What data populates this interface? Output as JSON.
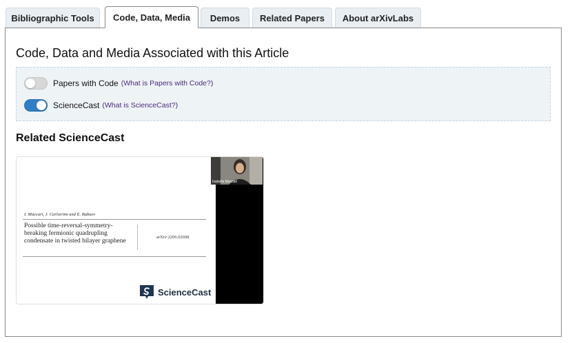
{
  "tabs": [
    {
      "label": "Bibliographic Tools"
    },
    {
      "label": "Code, Data, Media"
    },
    {
      "label": "Demos"
    },
    {
      "label": "Related Papers"
    },
    {
      "label": "About arXivLabs"
    }
  ],
  "active_tab": "Code, Data, Media",
  "panel": {
    "heading": "Code, Data and Media Associated with this Article",
    "toggles": [
      {
        "label": "Papers with Code",
        "link": "(What is Papers with Code?)",
        "enabled": false
      },
      {
        "label": "ScienceCast",
        "link": "(What is ScienceCast?)",
        "enabled": true
      }
    ],
    "related_heading": "Related ScienceCast"
  },
  "video": {
    "authors": "I. Maccari, J. Carlström and E. Babaev",
    "title": "Possible time-reversal-symmetry-breaking fermionic quadrupling condensate in twisted bilayer graphene",
    "arxiv_id": "arXiv:2206.02698",
    "brand": "ScienceCast",
    "presenter_caption": "Isabella Maccari"
  },
  "colors": {
    "toggle_on": "#2f7fc6",
    "toggle_off": "#d7d7d7",
    "link": "#4b2a7a",
    "annotation_arrow": "#e32b26"
  }
}
